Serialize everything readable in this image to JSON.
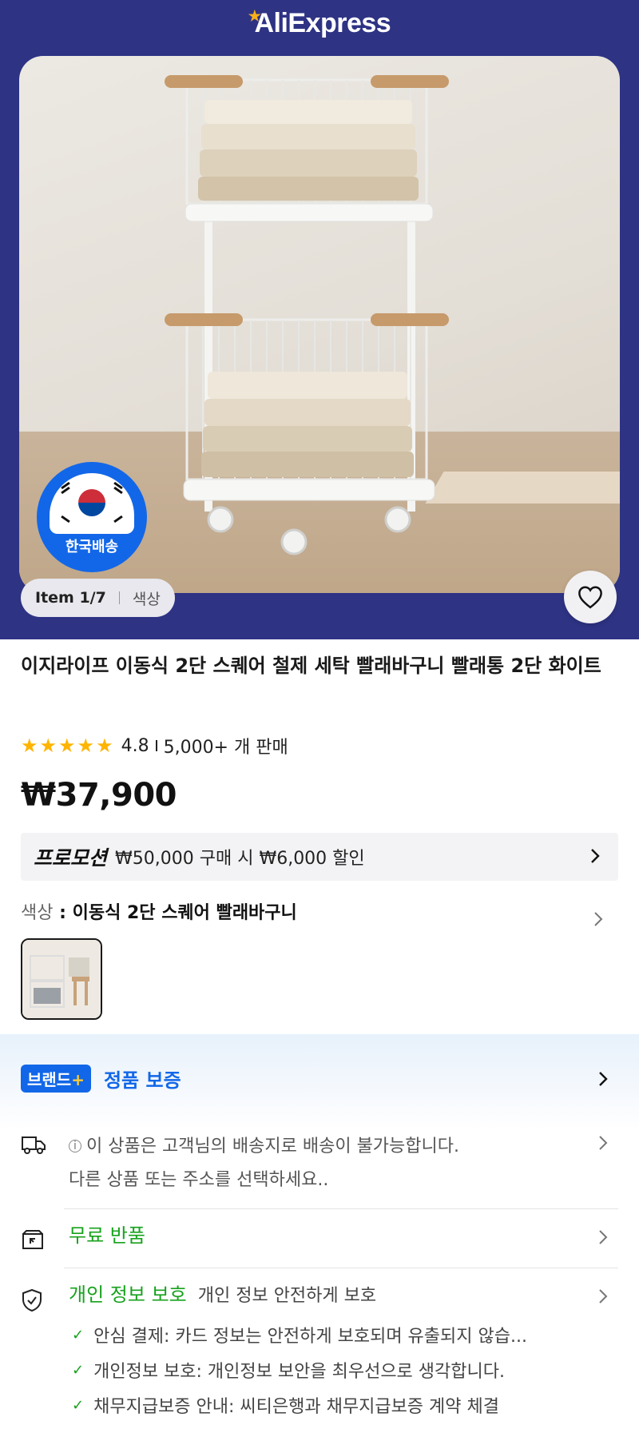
{
  "header": {
    "logo_text": "AliExpress"
  },
  "gallery": {
    "badge_label": "한국배송",
    "item_counter": "Item 1/7",
    "color_tab": "색상",
    "favorite_icon": "heart-icon"
  },
  "product": {
    "title": "이지라이프 이동식 2단 스퀘어 철제 세탁 빨래바구니 빨래통 2단 화이트",
    "rating": "4.8",
    "sold": "5,000+ 개 판매",
    "star_count": 5,
    "price": "₩37,900"
  },
  "promotion": {
    "tag": "프로모션",
    "text": "₩50,000 구매 시 ₩6,000 할인"
  },
  "variant": {
    "label": "색상",
    "separator": " : ",
    "value": "이동식 2단 스퀘어 빨래바구니"
  },
  "guarantee": {
    "brand_tag": "브랜드",
    "brand_plus": "+",
    "brand_text": "정품 보증"
  },
  "shipping": {
    "info_mark": "i",
    "line1": "이 상품은 고객님의 배송지로 배송이 불가능합니다.",
    "line2": "다른 상품 또는 주소를 선택하세요.."
  },
  "returns": {
    "label": "무료 반품"
  },
  "privacy": {
    "title": "개인 정보 보호",
    "subtitle": "개인 정보 안전하게 보호",
    "items": [
      "안심 결제: 카드 정보는 안전하게 보호되며 유출되지 않습...",
      "개인정보 보호: 개인정보 보안을 최우선으로 생각합니다.",
      "채무지급보증 안내: 씨티은행과 채무지급보증 계약 체결"
    ]
  },
  "colors": {
    "header_bg": "#2e3384",
    "accent_blue": "#1267e8",
    "green": "#17a21d",
    "star": "#ffb400"
  }
}
